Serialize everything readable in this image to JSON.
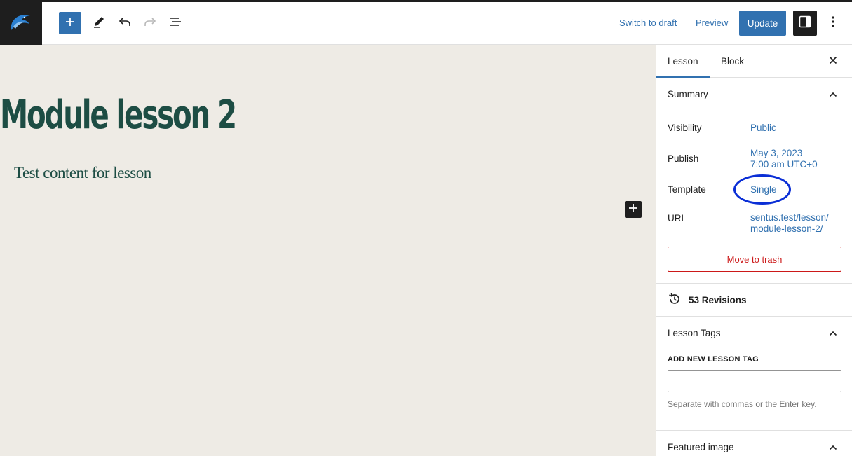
{
  "toolbar": {
    "switch_to_draft": "Switch to draft",
    "preview": "Preview",
    "update": "Update"
  },
  "post": {
    "title": "Module lesson 2",
    "paragraph": "Test content for lesson"
  },
  "sidebar": {
    "tabs": [
      "Lesson",
      "Block"
    ],
    "summary": {
      "title": "Summary",
      "visibility_label": "Visibility",
      "visibility_value": "Public",
      "publish_label": "Publish",
      "publish_date": "May 3, 2023",
      "publish_time": "7:00 am UTC+0",
      "template_label": "Template",
      "template_value": "Single",
      "url_label": "URL",
      "url_line1": "sentus.test/lesson/",
      "url_line2": "module-lesson-2/",
      "trash_label": "Move to trash"
    },
    "revisions": "53 Revisions",
    "lesson_tags": {
      "title": "Lesson Tags",
      "add_label": "ADD NEW LESSON TAG",
      "input_value": "",
      "help": "Separate with commas or the Enter key."
    },
    "featured_image": {
      "title": "Featured image"
    }
  },
  "colors": {
    "accent": "#3171b0",
    "dark": "#1e1e1e",
    "title_green": "#1d4d44",
    "canvas_bg": "#eeebe5",
    "danger": "#cc1818",
    "annotation": "#0b2fd6"
  },
  "icons": {
    "logo": "dolphin-logo-icon",
    "inserter": "plus-icon",
    "tools": "pencil-icon",
    "undo": "undo-icon",
    "redo": "redo-icon",
    "list_view": "list-view-icon",
    "settings": "sidebar-toggle-icon",
    "options": "vertical-ellipsis-icon",
    "close": "close-icon",
    "collapse": "chevron-up-icon",
    "revisions": "history-icon"
  }
}
